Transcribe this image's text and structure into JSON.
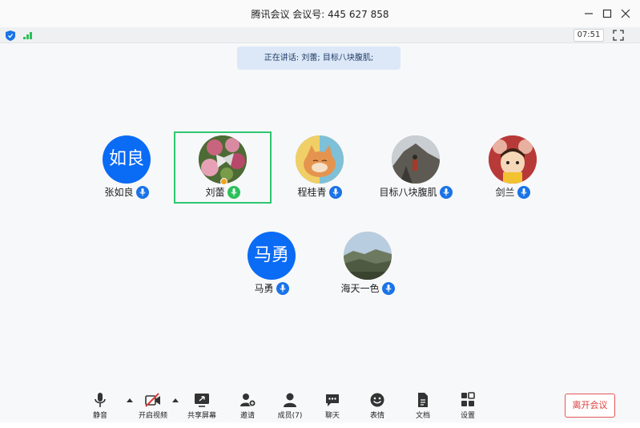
{
  "window": {
    "title": "腾讯会议 会议号: 445 627 858",
    "timer": "07:51"
  },
  "speaking_banner": "正在讲话: 刘蕾; 目标八块腹肌;",
  "participants": [
    {
      "name": "张如良",
      "avatar_text": "如良",
      "muted": false,
      "speaking": false
    },
    {
      "name": "刘蕾",
      "avatar_text": "",
      "muted": false,
      "speaking": true
    },
    {
      "name": "程桂青",
      "avatar_text": "",
      "muted": false,
      "speaking": false
    },
    {
      "name": "目标八块腹肌",
      "avatar_text": "",
      "muted": false,
      "speaking": false
    },
    {
      "name": "剑兰",
      "avatar_text": "",
      "muted": false,
      "speaking": false
    },
    {
      "name": "马勇",
      "avatar_text": "马勇",
      "muted": false,
      "speaking": false
    },
    {
      "name": "海天一色",
      "avatar_text": "",
      "muted": false,
      "speaking": false
    }
  ],
  "toolbar": {
    "mute": "静音",
    "video": "开启视频",
    "share": "共享屏幕",
    "invite": "邀请",
    "members": "成员(7)",
    "chat": "聊天",
    "emoji": "表情",
    "docs": "文档",
    "settings": "设置",
    "leave": "离开会议"
  },
  "colors": {
    "accent": "#0a6bf5",
    "speaking_border": "#2ec770",
    "leave": "#e03b3b",
    "banner_bg": "#dce8f7"
  }
}
